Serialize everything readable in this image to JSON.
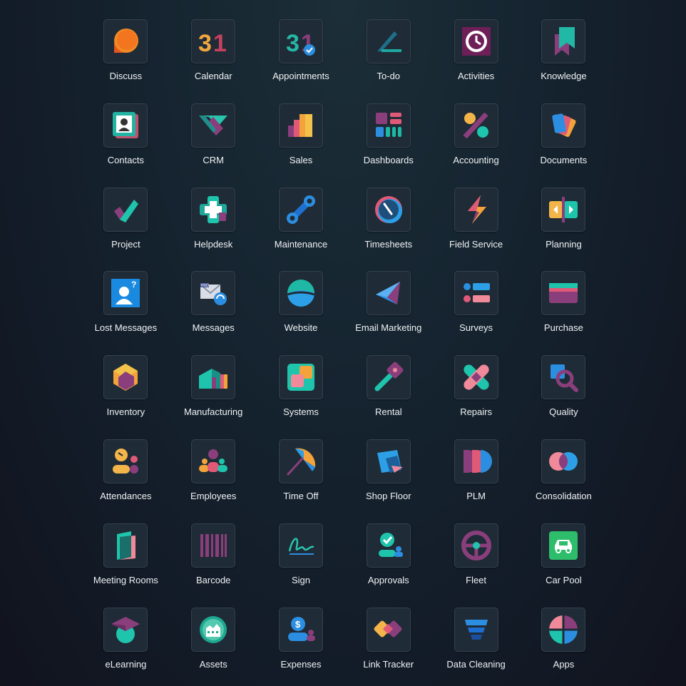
{
  "apps": [
    {
      "label": "Discuss",
      "icon": "discuss-icon"
    },
    {
      "label": "Calendar",
      "icon": "calendar-icon"
    },
    {
      "label": "Appointments",
      "icon": "appointments-icon"
    },
    {
      "label": "To-do",
      "icon": "todo-icon"
    },
    {
      "label": "Activities",
      "icon": "activities-icon"
    },
    {
      "label": "Knowledge",
      "icon": "knowledge-icon"
    },
    {
      "label": "Contacts",
      "icon": "contacts-icon"
    },
    {
      "label": "CRM",
      "icon": "crm-icon"
    },
    {
      "label": "Sales",
      "icon": "sales-icon"
    },
    {
      "label": "Dashboards",
      "icon": "dashboards-icon"
    },
    {
      "label": "Accounting",
      "icon": "accounting-icon"
    },
    {
      "label": "Documents",
      "icon": "documents-icon"
    },
    {
      "label": "Project",
      "icon": "project-icon"
    },
    {
      "label": "Helpdesk",
      "icon": "helpdesk-icon"
    },
    {
      "label": "Maintenance",
      "icon": "maintenance-icon"
    },
    {
      "label": "Timesheets",
      "icon": "timesheets-icon"
    },
    {
      "label": "Field Service",
      "icon": "field-service-icon"
    },
    {
      "label": "Planning",
      "icon": "planning-icon"
    },
    {
      "label": "Lost Messages",
      "icon": "lost-messages-icon"
    },
    {
      "label": "Messages",
      "icon": "messages-icon"
    },
    {
      "label": "Website",
      "icon": "website-icon"
    },
    {
      "label": "Email Marketing",
      "icon": "email-marketing-icon"
    },
    {
      "label": "Surveys",
      "icon": "surveys-icon"
    },
    {
      "label": "Purchase",
      "icon": "purchase-icon"
    },
    {
      "label": "Inventory",
      "icon": "inventory-icon"
    },
    {
      "label": "Manufacturing",
      "icon": "manufacturing-icon"
    },
    {
      "label": "Systems",
      "icon": "systems-icon"
    },
    {
      "label": "Rental",
      "icon": "rental-icon"
    },
    {
      "label": "Repairs",
      "icon": "repairs-icon"
    },
    {
      "label": "Quality",
      "icon": "quality-icon"
    },
    {
      "label": "Attendances",
      "icon": "attendances-icon"
    },
    {
      "label": "Employees",
      "icon": "employees-icon"
    },
    {
      "label": "Time Off",
      "icon": "time-off-icon"
    },
    {
      "label": "Shop Floor",
      "icon": "shop-floor-icon"
    },
    {
      "label": "PLM",
      "icon": "plm-icon"
    },
    {
      "label": "Consolidation",
      "icon": "consolidation-icon"
    },
    {
      "label": "Meeting Rooms",
      "icon": "meeting-rooms-icon"
    },
    {
      "label": "Barcode",
      "icon": "barcode-icon"
    },
    {
      "label": "Sign",
      "icon": "sign-icon"
    },
    {
      "label": "Approvals",
      "icon": "approvals-icon"
    },
    {
      "label": "Fleet",
      "icon": "fleet-icon"
    },
    {
      "label": "Car Pool",
      "icon": "car-pool-icon"
    },
    {
      "label": "eLearning",
      "icon": "elearning-icon"
    },
    {
      "label": "Assets",
      "icon": "assets-icon"
    },
    {
      "label": "Expenses",
      "icon": "expenses-icon"
    },
    {
      "label": "Link Tracker",
      "icon": "link-tracker-icon"
    },
    {
      "label": "Data Cleaning",
      "icon": "data-cleaning-icon"
    },
    {
      "label": "Apps",
      "icon": "apps-icon"
    }
  ]
}
